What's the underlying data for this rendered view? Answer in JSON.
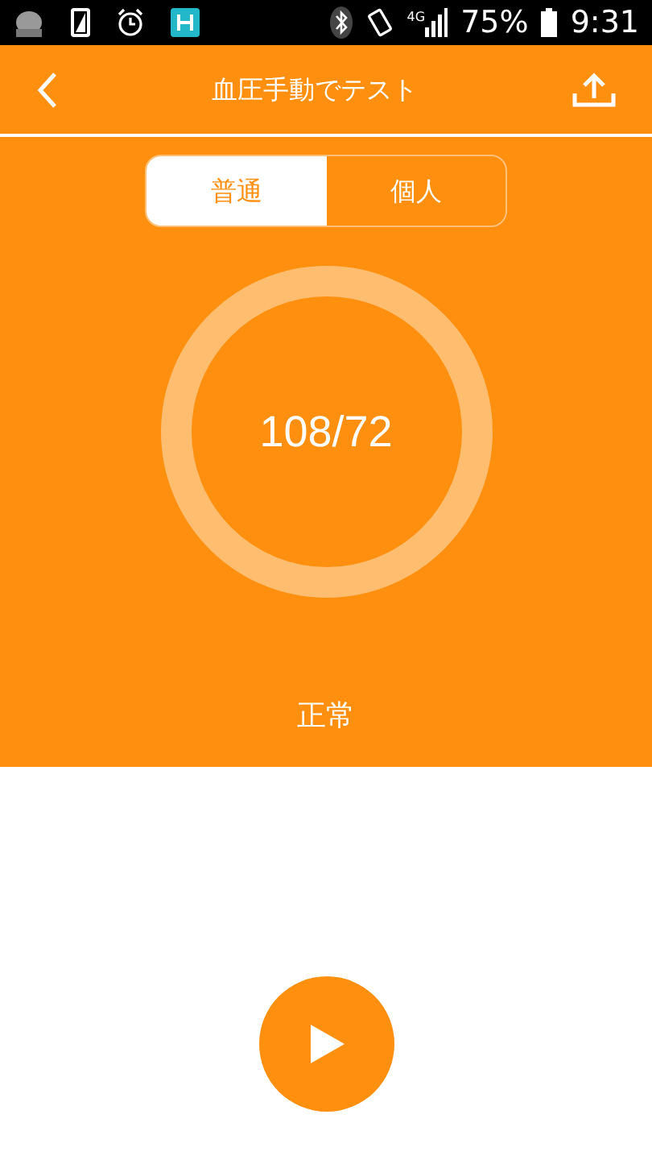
{
  "status_bar": {
    "network": "4G",
    "battery": "75%",
    "time": "9:31"
  },
  "header": {
    "title": "血圧手動でテスト"
  },
  "tabs": [
    {
      "label": "普通",
      "selected": true
    },
    {
      "label": "個人",
      "selected": false
    }
  ],
  "reading": {
    "value": "108/72",
    "status": "正常"
  }
}
